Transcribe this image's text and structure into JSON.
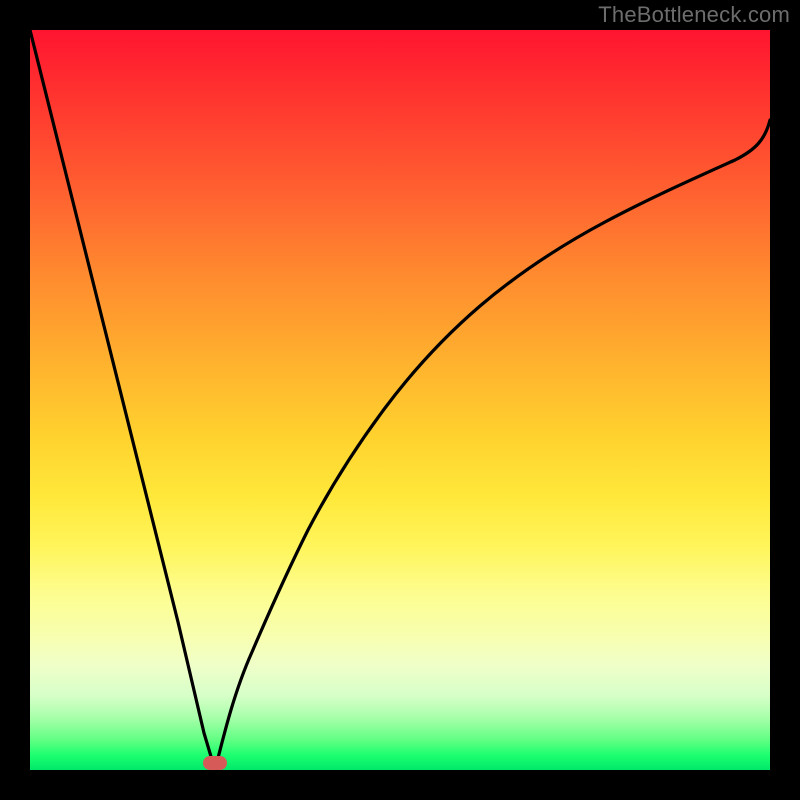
{
  "watermark": {
    "text": "TheBottleneck.com"
  },
  "chart_data": {
    "type": "line",
    "title": "",
    "xlabel": "",
    "ylabel": "",
    "xlim": [
      0,
      100
    ],
    "ylim": [
      0,
      100
    ],
    "grid": false,
    "legend": false,
    "annotations": [
      {
        "kind": "marker",
        "x": 25,
        "y": 0,
        "color": "#d65a58"
      }
    ],
    "gradient_stops": [
      {
        "pos": 0,
        "color": "#ff1430"
      },
      {
        "pos": 50,
        "color": "#ffd22e"
      },
      {
        "pos": 75,
        "color": "#fdfd8e"
      },
      {
        "pos": 100,
        "color": "#00e86a"
      }
    ],
    "series": [
      {
        "name": "bottleneck-curve-left",
        "x": [
          0,
          5,
          10,
          15,
          20,
          23.5,
          25
        ],
        "values": [
          100,
          80,
          60,
          40,
          20,
          5,
          0
        ]
      },
      {
        "name": "bottleneck-curve-right",
        "x": [
          25,
          27,
          30,
          33,
          36,
          40,
          45,
          50,
          56,
          63,
          70,
          78,
          86,
          93,
          100
        ],
        "values": [
          0,
          6,
          16,
          25,
          33,
          42,
          51,
          58,
          65,
          71,
          76,
          80,
          83.5,
          86,
          88
        ]
      }
    ],
    "marker_center_pct": {
      "x": 25.0,
      "y": 99.0
    }
  }
}
